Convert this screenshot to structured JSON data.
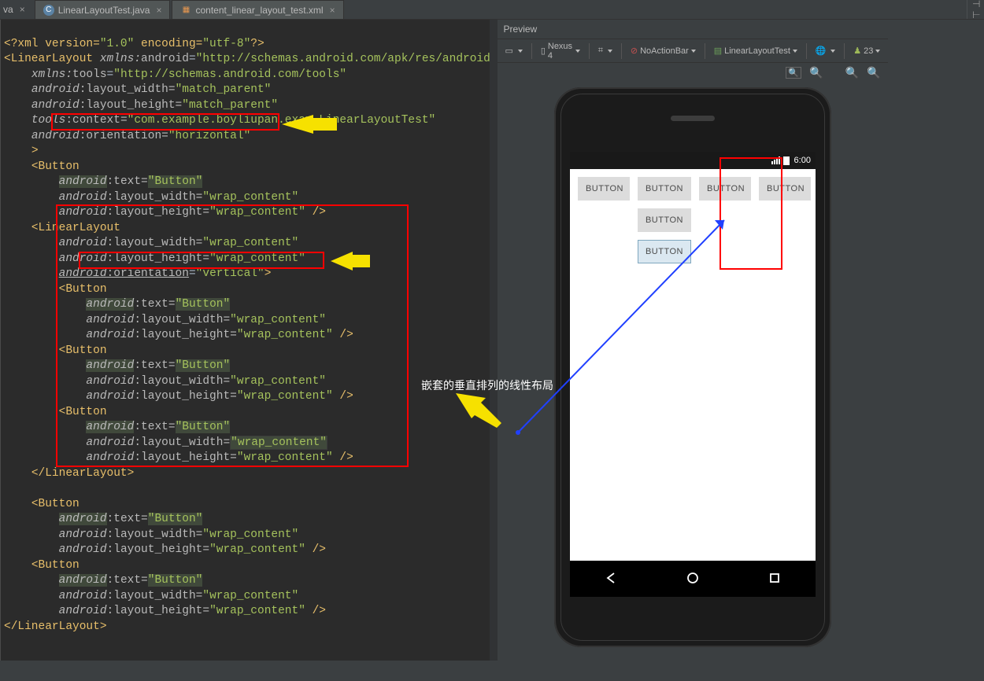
{
  "tabs": {
    "t0": "va",
    "t1": "LinearLayoutTest.java",
    "t2": "content_linear_layout_test.xml",
    "pin": "⊣ ⊢"
  },
  "code": {
    "l1a": "<?xml version=",
    "l1b": "\"1.0\"",
    "l1c": " encoding=",
    "l1d": "\"utf-8\"",
    "l1e": "?>",
    "l2a": "<LinearLayout ",
    "l2b": "xmlns:",
    "l2c": "android",
    "l2d": "=",
    "l2e": "\"http://schemas.android.com/apk/res/android\"",
    "l3a": "xmlns:",
    "l3b": "tools",
    "l3c": "=",
    "l3d": "\"http://schemas.android.com/tools\"",
    "l4a": "android",
    "l4b": ":layout_width=",
    "l4c": "\"match_parent\"",
    "l5a": "android",
    "l5b": ":layout_height=",
    "l5c": "\"match_parent\"",
    "l6a": "tools",
    "l6b": ":context=",
    "l6c": "\"com.example.boyliupan.exam.LinearLayoutTest\"",
    "l7a": "android",
    "l7b": ":orientation=",
    "l7c": "\"horizontal\"",
    "l8": ">",
    "l9a": "<Button",
    "l10a": "android",
    "l10b": ":text=",
    "l10c": "\"Button\"",
    "l11a": "android",
    "l11b": ":layout_width=",
    "l11c": "\"wrap_content\"",
    "l12a": "android",
    "l12b": ":layout_height=",
    "l12c": "\"wrap_content\"",
    "l12d": " />",
    "l13": "<LinearLayout",
    "l14a": "android",
    "l14b": ":layout_width=",
    "l14c": "\"wrap_content\"",
    "l15a": "android",
    "l15b": ":layout_height=",
    "l15c": "\"wrap_content\"",
    "l16a": "android",
    "l16b": ":orientation",
    "l16c": "=",
    "l16d": "\"vertical\"",
    "l16e": ">",
    "l17": "<Button",
    "l18a": "android",
    "l18b": ":text=",
    "l18c": "\"Button\"",
    "l19a": "android",
    "l19b": ":layout_width=",
    "l19c": "\"wrap_content\"",
    "l20a": "android",
    "l20b": ":layout_height=",
    "l20c": "\"wrap_content\"",
    "l20d": " />",
    "l21": "<Button",
    "l22a": "android",
    "l22b": ":text=",
    "l22c": "\"Button\"",
    "l23a": "android",
    "l23b": ":layout_width=",
    "l23c": "\"wrap_content\"",
    "l24a": "android",
    "l24b": ":layout_height=",
    "l24c": "\"wrap_content\"",
    "l24d": " />",
    "l25": "<Button",
    "l26a": "android",
    "l26b": ":text=",
    "l26c": "\"Button\"",
    "l27a": "android",
    "l27b": ":layout_width=",
    "l27c": "\"wrap_content\"",
    "l28a": "android",
    "l28b": ":layout_height=",
    "l28c": "\"wrap_content\"",
    "l28d": " />",
    "l29": "</LinearLayout>",
    "blank": "",
    "l31": "<Button",
    "l32a": "android",
    "l32b": ":text=",
    "l32c": "\"Button\"",
    "l33a": "android",
    "l33b": ":layout_width=",
    "l33c": "\"wrap_content\"",
    "l34a": "android",
    "l34b": ":layout_height=",
    "l34c": "\"wrap_content\"",
    "l34d": " />",
    "l35": "<Button",
    "l36a": "android",
    "l36b": ":text=",
    "l36c": "\"Button\"",
    "l37a": "android",
    "l37b": ":layout_width=",
    "l37c": "\"wrap_content\"",
    "l38a": "android",
    "l38b": ":layout_height=",
    "l38c": "\"wrap_content\"",
    "l38d": " />",
    "l39": "</LinearLayout>"
  },
  "annot": "嵌套的垂直排列的线性布局",
  "preview": {
    "title": "Preview",
    "device": "Nexus 4",
    "theme": "NoActionBar",
    "activity": "LinearLayoutTest",
    "api": "23",
    "time": "6:00",
    "btn": "BUTTON"
  }
}
